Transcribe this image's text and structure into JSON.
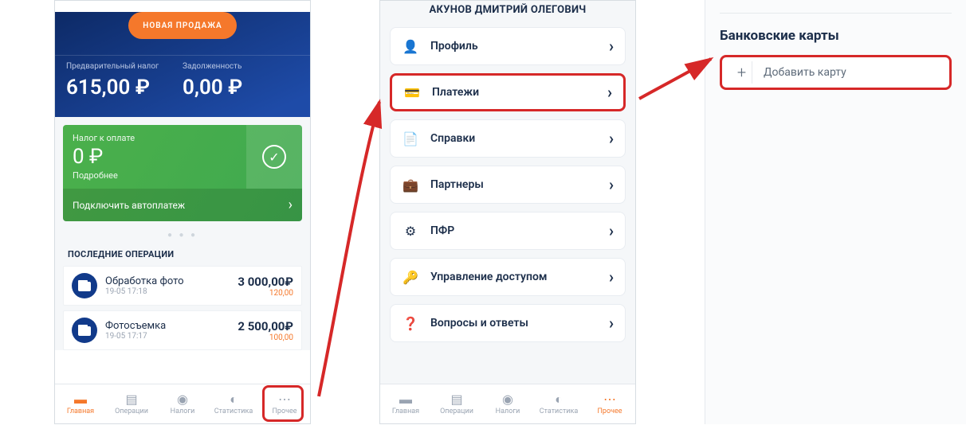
{
  "screen1": {
    "new_sale": "НОВАЯ ПРОДАЖА",
    "pretax_label": "Предварительный налог",
    "pretax_value": "615,00 ₽",
    "debt_label": "Задолженность",
    "debt_value": "0,00 ₽",
    "green": {
      "title": "Налог к оплате",
      "amount": "0 ₽",
      "more": "Подробнее",
      "autopay": "Подключить автоплатеж"
    },
    "last_ops_title": "ПОСЛЕДНИЕ ОПЕРАЦИИ",
    "ops": [
      {
        "title": "Обработка фото",
        "time": "19-05 17:18",
        "amount": "3 000,00₽",
        "tax": "120,00"
      },
      {
        "title": "Фотосъемка",
        "time": "19-05 17:17",
        "amount": "2 500,00₽",
        "tax": "100,00"
      }
    ]
  },
  "screen2": {
    "user_name": "АКУНОВ ДМИТРИЙ ОЛЕГОВИЧ",
    "items": [
      {
        "icon": "👤",
        "label": "Профиль"
      },
      {
        "icon": "💳",
        "label": "Платежи"
      },
      {
        "icon": "📄",
        "label": "Справки"
      },
      {
        "icon": "💼",
        "label": "Партнеры"
      },
      {
        "icon": "⚙",
        "label": "ПФР"
      },
      {
        "icon": "🔑",
        "label": "Управление доступом"
      },
      {
        "icon": "❓",
        "label": "Вопросы и ответы"
      }
    ]
  },
  "nav": {
    "items": [
      {
        "label": "Главная",
        "icon": "briefcase"
      },
      {
        "label": "Операции",
        "icon": "wallet"
      },
      {
        "label": "Налоги",
        "icon": "coins"
      },
      {
        "label": "Статистика",
        "icon": "moon"
      },
      {
        "label": "Прочее",
        "icon": "dots"
      }
    ]
  },
  "panel3": {
    "title": "Банковские карты",
    "add_card": "Добавить карту"
  }
}
